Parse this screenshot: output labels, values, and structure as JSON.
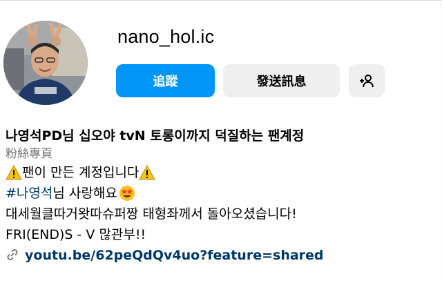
{
  "profile": {
    "username": "nano_hol.ic",
    "avatar_icon": "profile-photo"
  },
  "actions": {
    "follow_label": "追蹤",
    "message_label": "發送訊息",
    "add_user_icon": "add-user-icon"
  },
  "bio": {
    "name": "나영석PD님 십오야 tvN 토롱이까지 덕질하는 팬계정",
    "category": "粉絲專頁",
    "line1": "팬이 만든 계정입니다",
    "hashtag": "#나영석",
    "line2_rest": " 님 사랑해요",
    "line3": "대세월클따거왓따슈퍼짱 태형좌께서 돌아오셨습니다!",
    "line4": "FRI(END)S - V 많관부!!",
    "link": "youtu.be/62peQdQv4uo?feature=shared"
  },
  "colors": {
    "primary": "#0095f6",
    "secondary_bg": "#efefef",
    "link": "#00376b",
    "muted": "#737373"
  }
}
